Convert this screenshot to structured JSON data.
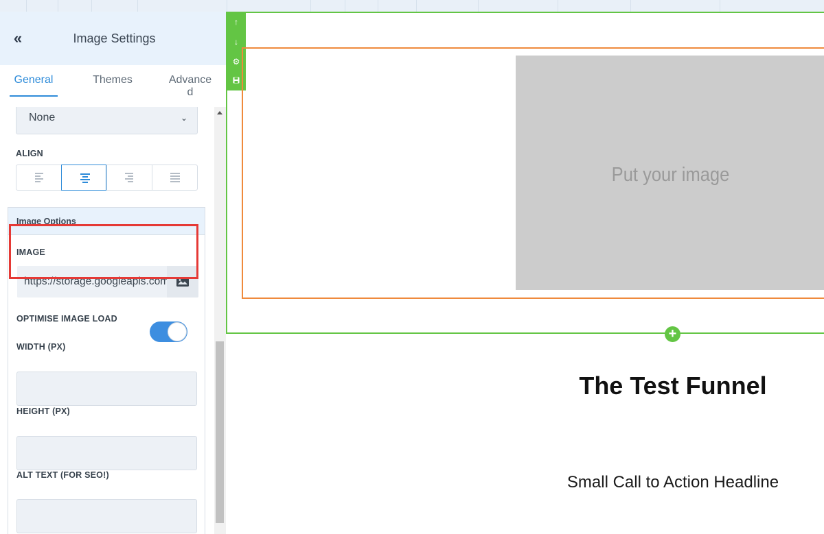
{
  "sidebar": {
    "title": "Image Settings",
    "collapse_glyph": "«",
    "tabs": [
      {
        "label": "General",
        "active": true
      },
      {
        "label": "Themes",
        "active": false
      },
      {
        "label": "Advance\nd",
        "active": false
      }
    ],
    "effect_select": {
      "value": "None"
    },
    "align": {
      "label": "ALIGN",
      "options": [
        "left",
        "center",
        "right",
        "justify"
      ],
      "selected": "center"
    },
    "image_options": {
      "heading": "Image Options",
      "image_label": "IMAGE",
      "image_url": "https://storage.googleapis.com",
      "optimise_label": "OPTIMISE IMAGE LOAD",
      "optimise_on": true,
      "width_label": "WIDTH (PX)",
      "width_value": "",
      "height_label": "HEIGHT (PX)",
      "height_value": "",
      "alt_label": "ALT TEXT (FOR SEO!)",
      "alt_value": ""
    }
  },
  "canvas": {
    "tools": [
      "↑",
      "↓",
      "⚙",
      "💾"
    ],
    "image_placeholder": "Put your image",
    "headline": "The Test Funnel",
    "subheadline": "Small Call to Action Headline",
    "add_glyph": "+"
  },
  "colors": {
    "accent_blue": "#2d8bd9",
    "frame_green": "#63c544",
    "frame_orange": "#ef8a3c",
    "highlight_red": "#e53935"
  }
}
